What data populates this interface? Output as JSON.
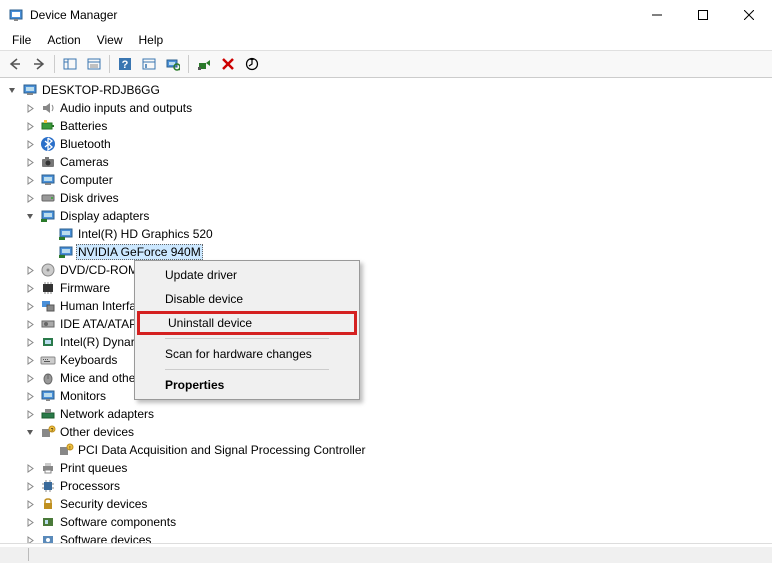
{
  "window": {
    "title": "Device Manager"
  },
  "menubar": {
    "file": "File",
    "action": "Action",
    "view": "View",
    "help": "Help"
  },
  "tree": {
    "root": "DESKTOP-RDJB6GG",
    "audio": "Audio inputs and outputs",
    "batteries": "Batteries",
    "bluetooth": "Bluetooth",
    "cameras": "Cameras",
    "computer": "Computer",
    "disk": "Disk drives",
    "display": "Display adapters",
    "intel_gpu": "Intel(R) HD Graphics 520",
    "nvidia_gpu": "NVIDIA GeForce 940M",
    "dvd": "DVD/CD-ROM",
    "firmware": "Firmware",
    "hid": "Human Interfa",
    "ide": "IDE ATA/ATAP",
    "dynamic": "Intel(R) Dynar",
    "keyboards": "Keyboards",
    "mice": "Mice and othe",
    "monitors": "Monitors",
    "network": "Network adapters",
    "other": "Other devices",
    "pci_unknown": "PCI Data Acquisition and Signal Processing Controller",
    "printq": "Print queues",
    "processors": "Processors",
    "security": "Security devices",
    "swcomp": "Software components",
    "swdev": "Software devices"
  },
  "context_menu": {
    "update": "Update driver",
    "disable": "Disable device",
    "uninstall": "Uninstall device",
    "scan": "Scan for hardware changes",
    "properties": "Properties"
  }
}
